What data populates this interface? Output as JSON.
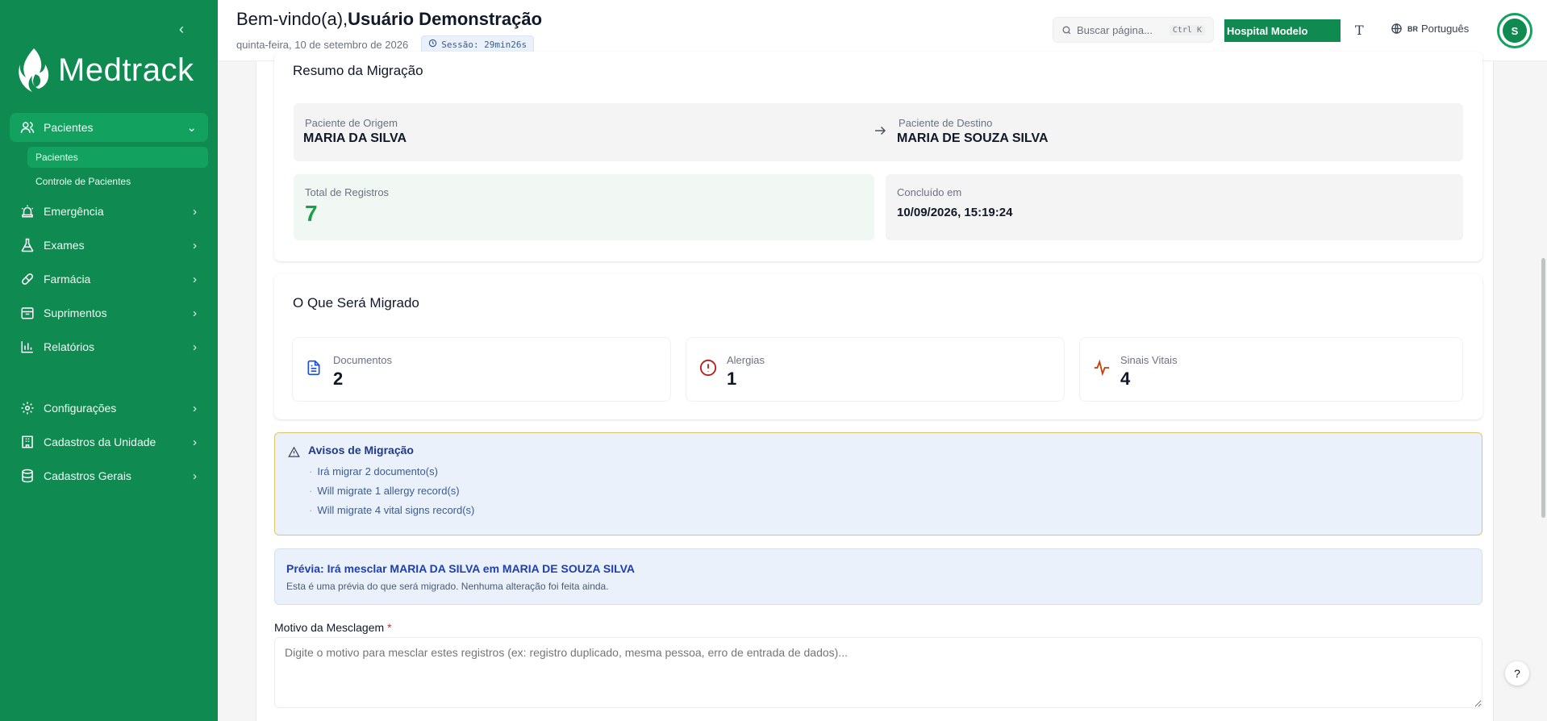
{
  "sidebar": {
    "logo": "Medtrack",
    "items": [
      {
        "label": "Pacientes",
        "icon": "users-icon"
      },
      {
        "label": "Emergência",
        "icon": "siren-icon"
      },
      {
        "label": "Exames",
        "icon": "flask-icon"
      },
      {
        "label": "Farmácia",
        "icon": "pill-icon"
      },
      {
        "label": "Suprimentos",
        "icon": "box-icon"
      },
      {
        "label": "Relatórios",
        "icon": "chart-icon"
      },
      {
        "label": "Configurações",
        "icon": "gear-icon"
      },
      {
        "label": "Cadastros da Unidade",
        "icon": "building-icon"
      },
      {
        "label": "Cadastros Gerais",
        "icon": "database-icon"
      }
    ],
    "subitems": [
      {
        "label": "Pacientes"
      },
      {
        "label": "Controle de Pacientes"
      }
    ]
  },
  "header": {
    "welcome": "Bem-vindo(a),",
    "user": "Usuário Demonstração",
    "date": "quinta-feira, 10 de setembro de 2026",
    "session": "Sessão: 29min26s",
    "search_placeholder": "Buscar página...",
    "search_shortcut": "Ctrl K",
    "hospital": "Hospital Modelo",
    "font_toggle": "T",
    "lang_flag": "BR",
    "lang": "Português",
    "avatar_initial": "S"
  },
  "summary": {
    "title": "Resumo da Migração",
    "origin_label": "Paciente de Origem",
    "origin_name": "MARIA DA SILVA",
    "dest_label": "Paciente de Destino",
    "dest_name": "MARIA DE SOUZA SILVA",
    "total_label": "Total de Registros",
    "total_value": "7",
    "concluded_label": "Concluído em",
    "concluded_value": "10/09/2026, 15:19:24"
  },
  "migrated": {
    "title": "O Que Será Migrado",
    "stats": [
      {
        "label": "Documentos",
        "value": "2",
        "icon": "document-icon"
      },
      {
        "label": "Alergias",
        "value": "1",
        "icon": "alert-circle-icon"
      },
      {
        "label": "Sinais Vitais",
        "value": "4",
        "icon": "activity-icon"
      }
    ]
  },
  "warnings": {
    "title": "Avisos de Migração",
    "items": [
      "Irá migrar 2 documento(s)",
      "Will migrate 1 allergy record(s)",
      "Will migrate 4 vital signs record(s)"
    ]
  },
  "preview": {
    "title": "Prévia: Irá mesclar MARIA DA SILVA em MARIA DE SOUZA SILVA",
    "text": "Esta é uma prévia do que será migrado. Nenhuma alteração foi feita ainda."
  },
  "reason": {
    "label": "Motivo da Mesclagem",
    "required": "*",
    "placeholder": "Digite o motivo para mesclar estes registros (ex: registro duplicado, mesma pessoa, erro de entrada de dados)..."
  },
  "help": "?",
  "colors": {
    "brand": "#0f8a50",
    "brand_active": "#13a15f",
    "total_green": "#16a34a",
    "warning_border": "#e3c46a",
    "preview_blue": "#1e40af"
  }
}
